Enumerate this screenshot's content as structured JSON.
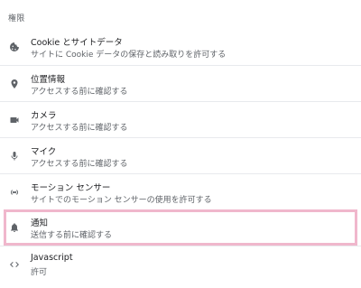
{
  "section": {
    "title": "権限"
  },
  "items": [
    {
      "label": "Cookie とサイトデータ",
      "sub": "サイトに Cookie データの保存と読み取りを許可する",
      "icon": "cookie-icon"
    },
    {
      "label": "位置情報",
      "sub": "アクセスする前に確認する",
      "icon": "location-pin-icon"
    },
    {
      "label": "カメラ",
      "sub": "アクセスする前に確認する",
      "icon": "camera-icon"
    },
    {
      "label": "マイク",
      "sub": "アクセスする前に確認する",
      "icon": "microphone-icon"
    },
    {
      "label": "モーション センサー",
      "sub": "サイトでのモーション センサーの使用を許可する",
      "icon": "motion-sensor-icon"
    },
    {
      "label": "通知",
      "sub": "送信する前に確認する",
      "icon": "bell-icon"
    },
    {
      "label": "Javascript",
      "sub": "許可",
      "icon": "code-brackets-icon"
    }
  ],
  "colors": {
    "highlight": "#f0b7cc",
    "icon": "#5f6368",
    "divider": "#e8eaed"
  }
}
